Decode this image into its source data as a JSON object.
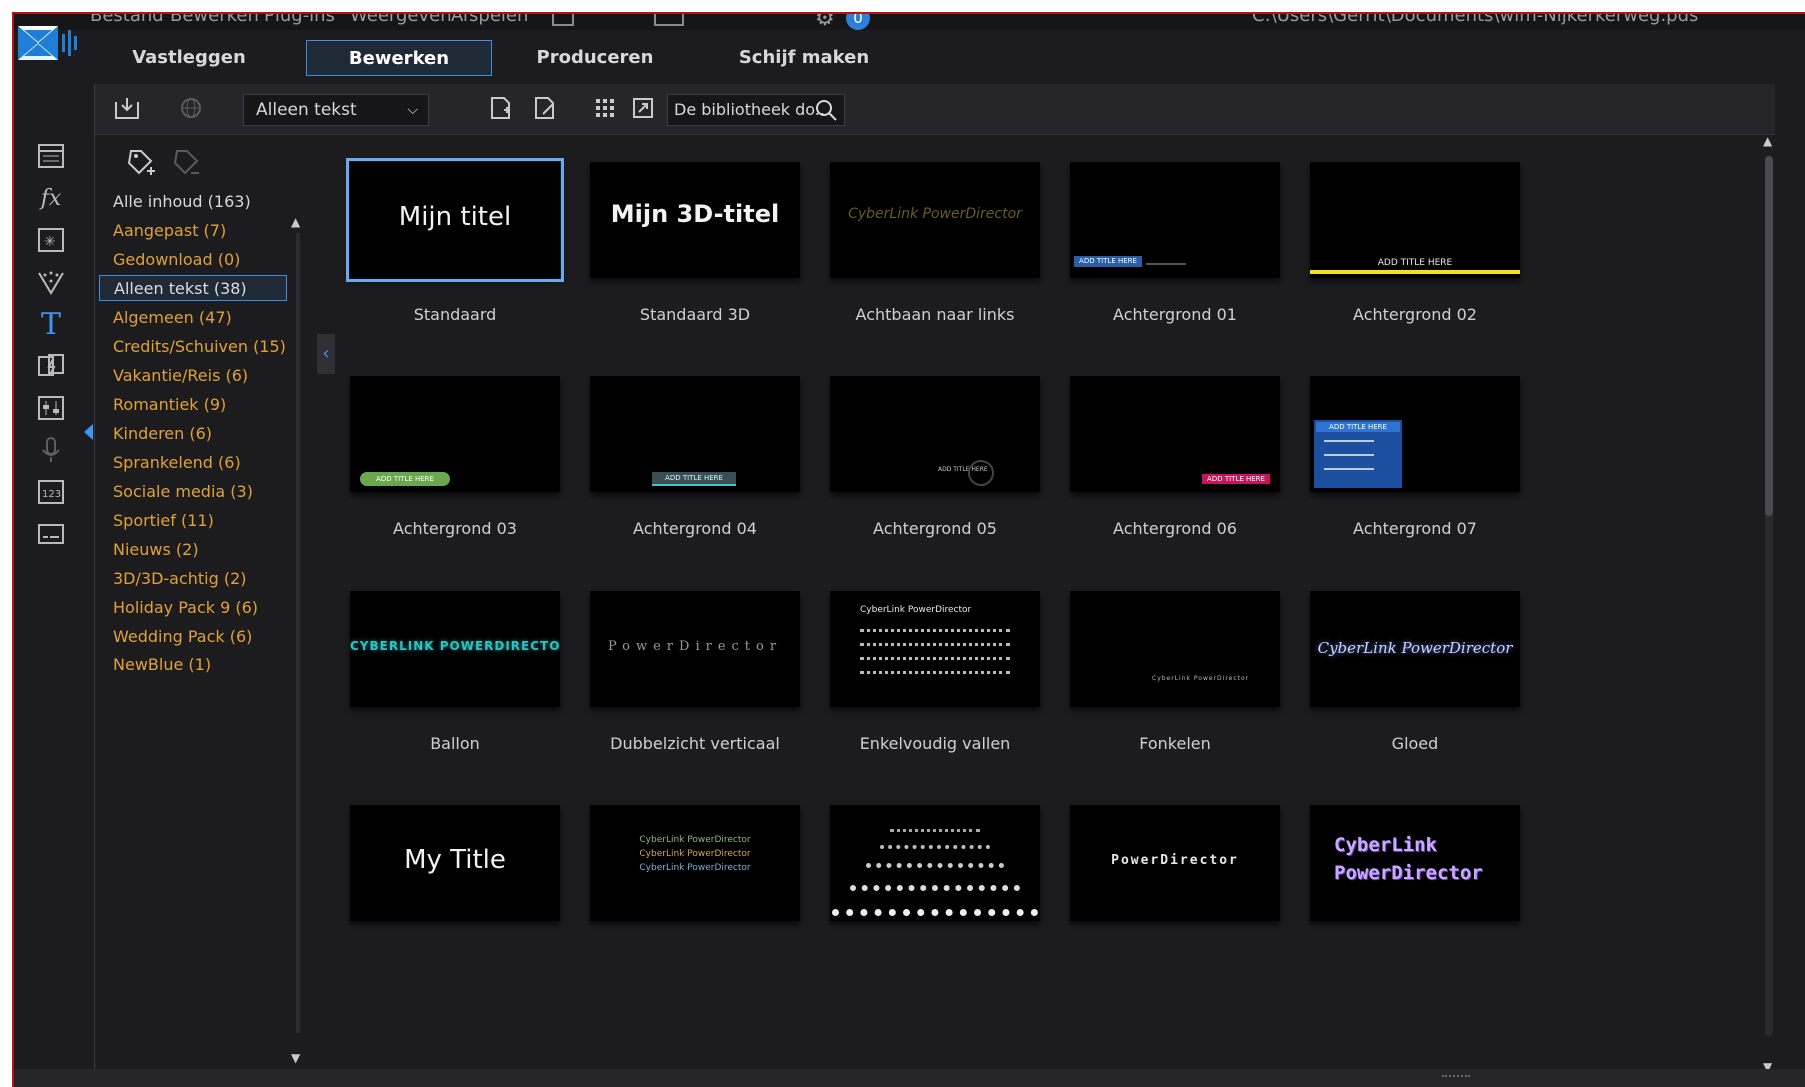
{
  "window": {
    "menu": [
      "Bestand",
      "Bewerken",
      "Plug-ins",
      "Weergeven",
      "Afspelen"
    ],
    "file_path": "C:\\Users\\Gerrit\\Documents\\wim-Nijkerkerweg.pds",
    "badge": "0"
  },
  "mode_tabs": [
    "Vastleggen",
    "Bewerken",
    "Produceren",
    "Schijf maken"
  ],
  "active_tab": "Bewerken",
  "rail_icons": [
    "media-room-icon",
    "fx-icon",
    "pip-objects-icon",
    "particle-icon",
    "title-icon",
    "transition-icon",
    "audio-mix-icon",
    "voice-over-icon",
    "chapter-icon",
    "subtitle-icon"
  ],
  "toolbar": {
    "filter_value": "Alleen tekst",
    "search_placeholder": "De bibliotheek do..."
  },
  "categories": [
    {
      "label": "Alle inhoud (163)"
    },
    {
      "label": "Aangepast  (7)"
    },
    {
      "label": "Gedownload  (0)"
    },
    {
      "label": "Alleen tekst  (38)"
    },
    {
      "label": "Algemeen  (47)"
    },
    {
      "label": "Credits/Schuiven  (15)"
    },
    {
      "label": "Vakantie/Reis  (6)"
    },
    {
      "label": "Romantiek  (9)"
    },
    {
      "label": "Kinderen  (6)"
    },
    {
      "label": "Sprankelend  (6)"
    },
    {
      "label": "Sociale media  (3)"
    },
    {
      "label": "Sportief  (11)"
    },
    {
      "label": "Nieuws  (2)"
    },
    {
      "label": "3D/3D-achtig  (2)"
    },
    {
      "label": "Holiday Pack 9  (6)"
    },
    {
      "label": "Wedding Pack  (6)"
    },
    {
      "label": "NewBlue  (1)"
    }
  ],
  "selected_category": "Alleen tekst  (38)",
  "templates": [
    {
      "caption": "Standaard",
      "thumb_text": "Mijn titel"
    },
    {
      "caption": "Standaard 3D",
      "thumb_text": "Mijn 3D-titel"
    },
    {
      "caption": "Achtbaan naar links",
      "thumb_text": "CyberLink PowerDirector"
    },
    {
      "caption": "Achtergrond 01",
      "thumb_text": "ADD TITLE HERE"
    },
    {
      "caption": "Achtergrond 02",
      "thumb_text": "ADD TITLE HERE"
    },
    {
      "caption": "Achtergrond 03",
      "thumb_text": "ADD TITLE HERE"
    },
    {
      "caption": "Achtergrond 04",
      "thumb_text": "ADD TITLE HERE"
    },
    {
      "caption": "Achtergrond 05",
      "thumb_text": "ADD TITLE HERE"
    },
    {
      "caption": "Achtergrond 06",
      "thumb_text": "ADD TITLE HERE"
    },
    {
      "caption": "Achtergrond 07",
      "thumb_text": "ADD TITLE HERE"
    },
    {
      "caption": "Ballon",
      "thumb_text": "CYBERLINK POWERDIRECTOR"
    },
    {
      "caption": "Dubbelzicht verticaal",
      "thumb_text": "PowerDirector"
    },
    {
      "caption": "Enkelvoudig vallen",
      "thumb_text": "CyberLink PowerDirector"
    },
    {
      "caption": "Fonkelen",
      "thumb_text": "CyberLink PowerDirector"
    },
    {
      "caption": "Gloed",
      "thumb_text": "CyberLink PowerDirector"
    },
    {
      "caption": "",
      "thumb_text": "My Title"
    },
    {
      "caption": "",
      "thumb_text": "CyberLink PowerDirector"
    },
    {
      "caption": "",
      "thumb_text": ""
    },
    {
      "caption": "",
      "thumb_text": "PowerDirector"
    },
    {
      "caption": "",
      "thumb_text": "CyberLink PowerDirector"
    }
  ],
  "selected_template": "Standaard",
  "colors": {
    "accent": "#3d8ee6",
    "category_text": "#e0a13a",
    "background": "#1c1c1f"
  }
}
